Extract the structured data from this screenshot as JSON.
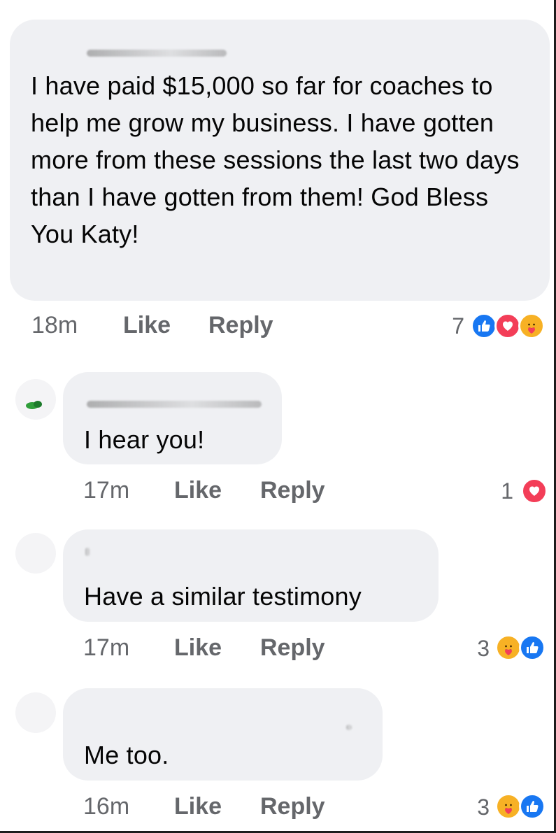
{
  "colors": {
    "bubble_bg": "#eff0f3",
    "meta_text": "#65676b",
    "body_text": "#050505",
    "like_blue": "#1877f2",
    "love_red": "#f33e58",
    "care_yellow": "#f7b125"
  },
  "comments": [
    {
      "text": "I have paid $15,000 so far for coaches to help me grow my business.  I have gotten more from these sessions the last two days than I have gotten from them!  God Bless You Katy!",
      "time": "18m",
      "like_label": "Like",
      "reply_label": "Reply",
      "reaction_count": "7",
      "reactions": [
        "like-icon",
        "love-icon",
        "care-icon"
      ]
    },
    {
      "text": "I hear you!",
      "time": "17m",
      "like_label": "Like",
      "reply_label": "Reply",
      "reaction_count": "1",
      "reactions": [
        "love-icon"
      ]
    },
    {
      "text": "Have a similar testimony",
      "time": "17m",
      "like_label": "Like",
      "reply_label": "Reply",
      "reaction_count": "3",
      "reactions": [
        "care-icon",
        "like-icon"
      ]
    },
    {
      "text": "Me too.",
      "time": "16m",
      "like_label": "Like",
      "reply_label": "Reply",
      "reaction_count": "3",
      "reactions": [
        "care-icon",
        "like-icon"
      ]
    }
  ]
}
